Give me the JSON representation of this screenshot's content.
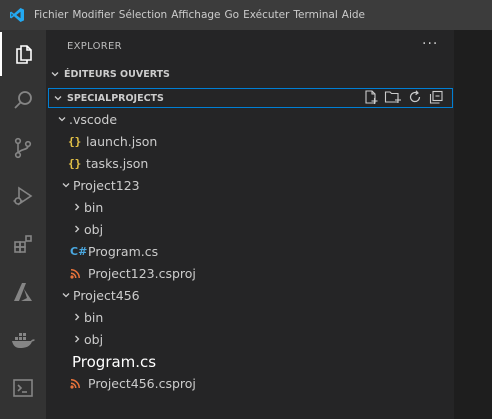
{
  "menu": [
    "Fichier",
    "Modifier",
    "Sélection",
    "Affichage",
    "Go",
    "Exécuter",
    "Terminal",
    "Aide"
  ],
  "colors": {
    "accent": "#007fd4",
    "json": "#e8c547",
    "csharp": "#4aa8e0",
    "csproj": "#e8733a"
  },
  "activity_icons": [
    "explorer-icon",
    "search-icon",
    "source-control-icon",
    "run-debug-icon",
    "extensions-icon",
    "azure-icon",
    "docker-icon",
    "terminal-icon"
  ],
  "explorer": {
    "title": "EXPLORER",
    "more": "···",
    "open_editors": "ÉDITEURS OUVERTS",
    "workspace": "SPECIALPROJECTS",
    "tree": {
      "vscode": ".vscode",
      "launch": "launch.json",
      "tasks": "tasks.json",
      "p123": "Project123",
      "bin1": "bin",
      "obj1": "obj",
      "program1": "Program.cs",
      "csproj1": "Project123.csproj",
      "p456": "Project456",
      "bin2": "bin",
      "obj2": "obj",
      "program2": "Program.cs",
      "csproj2": "Project456.csproj"
    }
  }
}
